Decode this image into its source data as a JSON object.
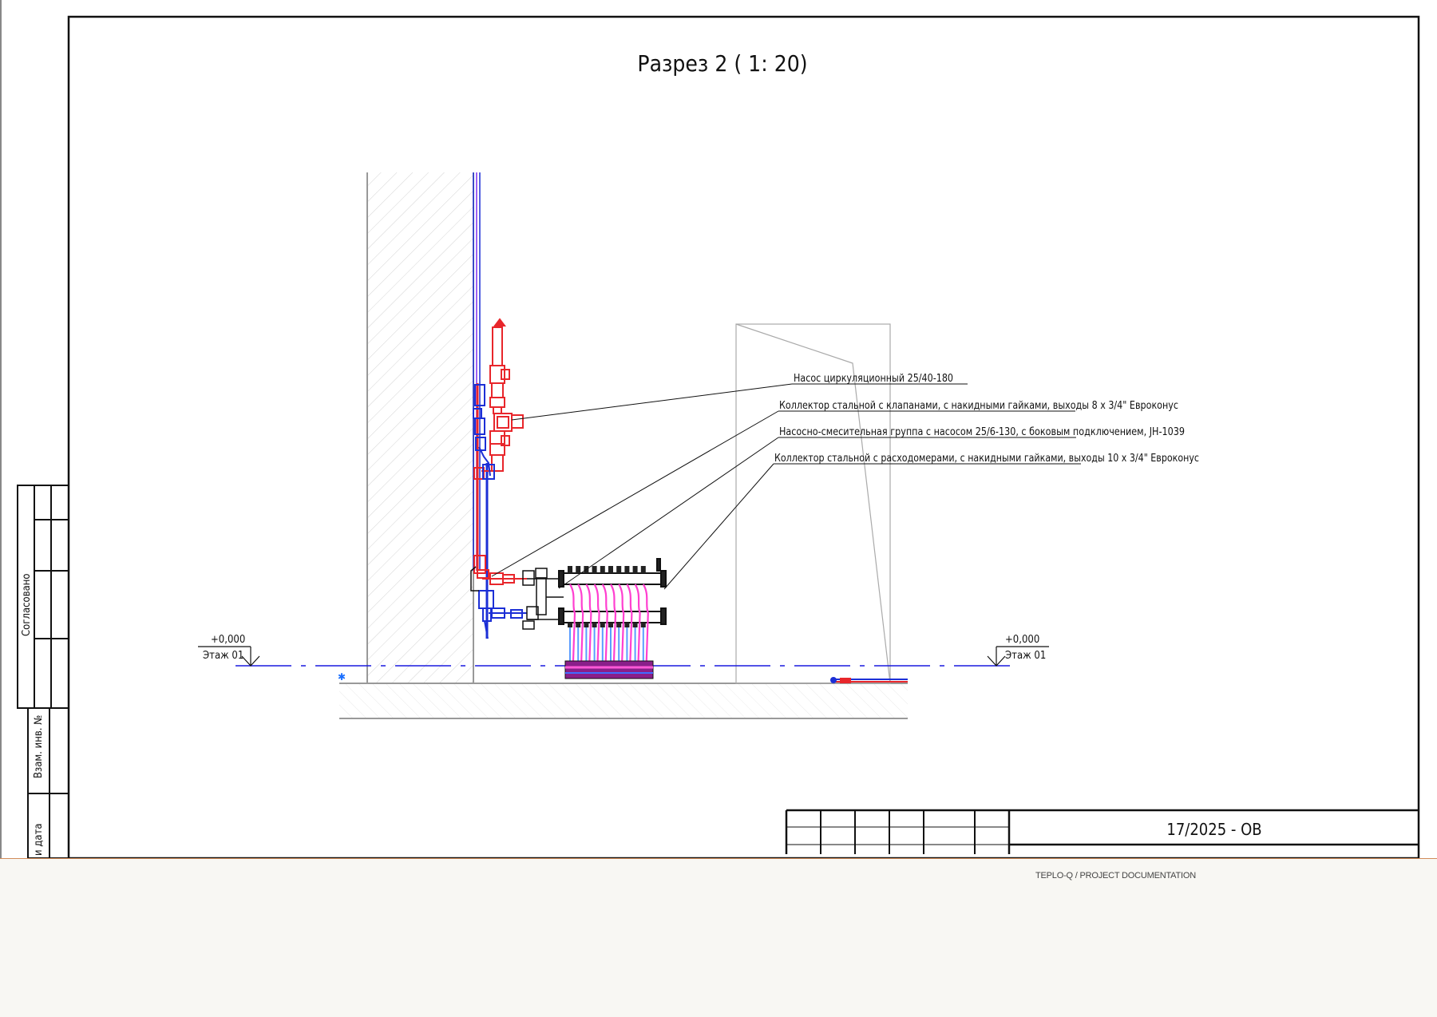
{
  "sheet": {
    "title": "Разрез 2 ( 1: 20)",
    "drawing_code": "17/2025 - ОВ"
  },
  "side_stamp": {
    "agreed": "Согласовано",
    "replacement_inv": "Взам. инв. №",
    "sign_date": "и дата"
  },
  "levels": {
    "left": {
      "value": "+0,000",
      "name": "Этаж 01"
    },
    "right": {
      "value": "+0,000",
      "name": "Этаж 01"
    }
  },
  "callouts": [
    {
      "text": "Насос циркуляционный 25/40-180"
    },
    {
      "text": "Коллектор стальной с клапанами, с накидными гайками, выходы 8 x 3/4\" Евроконус"
    },
    {
      "text": "Насосно-смесительная группа с насосом 25/6-130, с боковым подключением, JH-1039"
    },
    {
      "text": "Коллектор стальной с расходомерами, с накидными гайками, выходы 10 x 3/4\" Евроконус"
    }
  ],
  "footer": {
    "text": "TEPLO-Q / PROJECT DOCUMENTATION"
  },
  "colors": {
    "supply": "#e8262b",
    "return": "#1c2fd6",
    "loops": "#ff3fd0",
    "loops_return": "#5a9cff",
    "level_line": "#1a1adf",
    "accent_border": "#d18c5a"
  }
}
